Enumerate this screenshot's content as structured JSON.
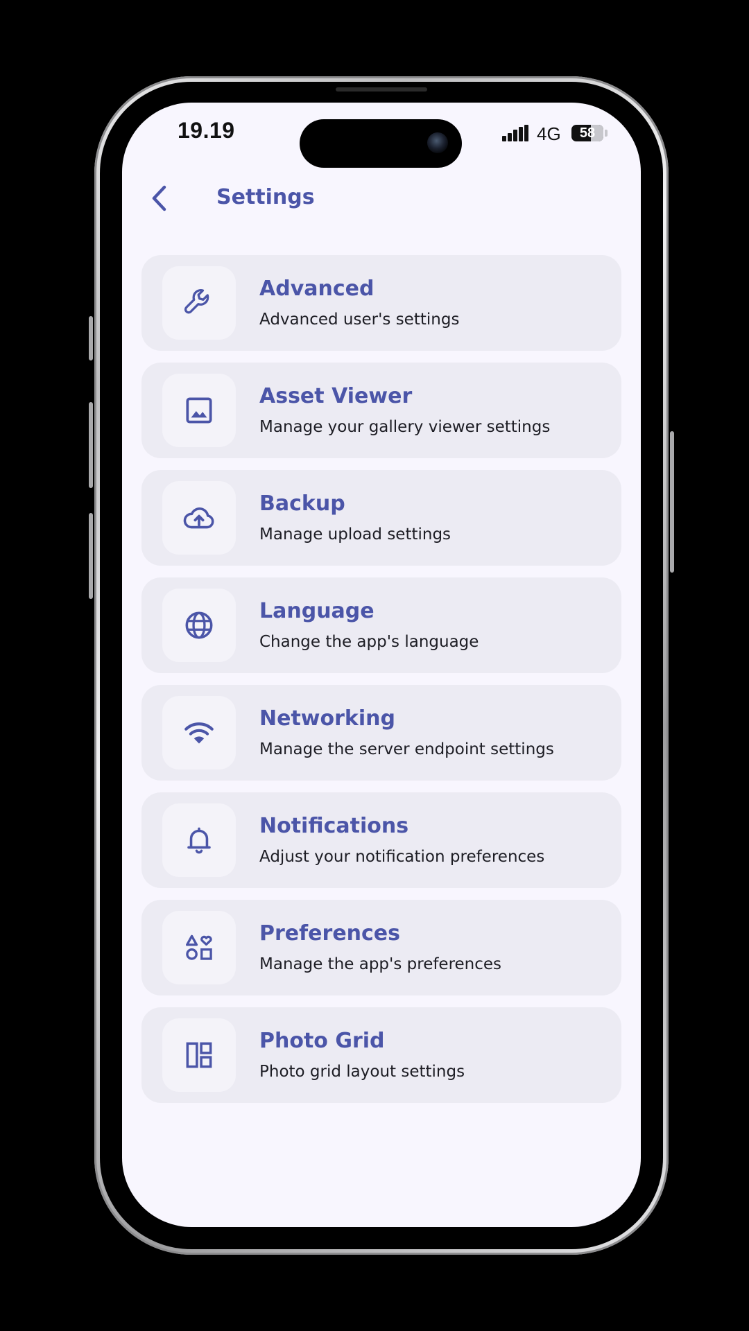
{
  "status_bar": {
    "time": "19.19",
    "network": "4G",
    "battery": "58"
  },
  "app_bar": {
    "title": "Settings",
    "back_icon": "chevron-left-icon"
  },
  "settings": [
    {
      "title": "Advanced",
      "subtitle": "Advanced user's settings",
      "icon": "wrench-icon"
    },
    {
      "title": "Asset Viewer",
      "subtitle": "Manage your gallery viewer settings",
      "icon": "image-icon"
    },
    {
      "title": "Backup",
      "subtitle": "Manage upload settings",
      "icon": "cloud-upload-icon"
    },
    {
      "title": "Language",
      "subtitle": "Change the app's language",
      "icon": "globe-icon"
    },
    {
      "title": "Networking",
      "subtitle": "Manage the server endpoint settings",
      "icon": "wifi-icon"
    },
    {
      "title": "Notifications",
      "subtitle": "Adjust your notification preferences",
      "icon": "bell-icon"
    },
    {
      "title": "Preferences",
      "subtitle": "Manage the app's preferences",
      "icon": "shapes-icon"
    },
    {
      "title": "Photo Grid",
      "subtitle": "Photo grid layout settings",
      "icon": "grid-layout-icon"
    }
  ],
  "colors": {
    "accent": "#4b55a8",
    "screen_bg": "#f8f6fe",
    "card_bg": "#ecebf3",
    "icon_tile_bg": "#f4f3f9",
    "subtitle_text": "#1d1d24"
  }
}
